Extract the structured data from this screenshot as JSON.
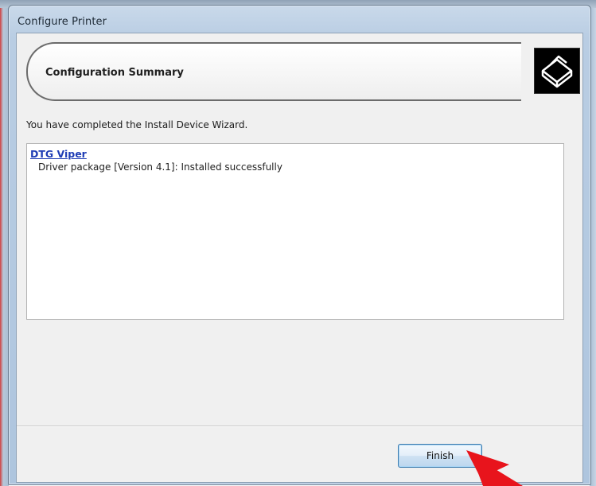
{
  "window": {
    "title": "Configure Printer"
  },
  "banner": {
    "title": "Configuration Summary",
    "icon": "printer-icon"
  },
  "intro_text": "You have completed the Install Device Wizard.",
  "results": {
    "device_name": "DTG Viper",
    "status_line": "Driver package [Version 4.1]: Installed successfully"
  },
  "footer": {
    "finish_label": "Finish"
  },
  "colors": {
    "link": "#1f3db5",
    "arrow": "#e8141c",
    "button_border": "#3d7bad"
  }
}
